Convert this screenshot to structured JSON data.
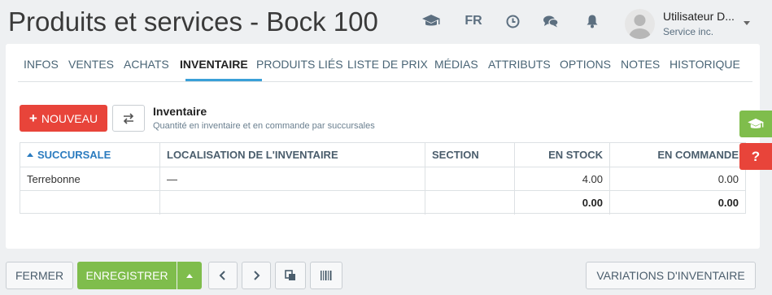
{
  "header": {
    "title": "Produits et services - Bock 100",
    "language": "FR",
    "icons": [
      "graduation-cap-icon",
      "clock-icon",
      "chat-icon",
      "bell-icon"
    ],
    "user": {
      "name": "Utilisateur D...",
      "org": "Service inc."
    }
  },
  "tabs": [
    "INFOS",
    "VENTES",
    "ACHATS",
    "INVENTAIRE",
    "PRODUITS LIÉS",
    "LISTE DE PRIX",
    "MÉDIAS",
    "ATTRIBUTS",
    "OPTIONS",
    "NOTES",
    "HISTORIQUE"
  ],
  "active_tab": "INVENTAIRE",
  "toolbar": {
    "new_label": "NOUVEAU",
    "new_icon": "plus-icon",
    "swap_icon": "swap-arrows-icon"
  },
  "section": {
    "title": "Inventaire",
    "subtitle": "Quantité en inventaire et en commande par succursales"
  },
  "table": {
    "columns": [
      "SUCCURSALE",
      "LOCALISATION DE L'INVENTAIRE",
      "SECTION",
      "EN STOCK",
      "EN COMMANDE"
    ],
    "sorted_column": "SUCCURSALE",
    "rows": [
      {
        "succursale": "Terrebonne",
        "localisation": "—",
        "section": "",
        "en_stock": "4.00",
        "en_commande": "0.00"
      }
    ],
    "totals": {
      "en_stock": "0.00",
      "en_commande": "0.00"
    }
  },
  "side": {
    "help_icon": "graduation-cap-icon",
    "question_label": "?"
  },
  "footer": {
    "close_label": "FERMER",
    "save_label": "ENREGISTRER",
    "variations_label": "VARIATIONS D'INVENTAIRE"
  },
  "colors": {
    "accent_red": "#e8443a",
    "accent_green": "#7fbd4c",
    "tab_underline": "#3aa0d8",
    "sort_blue": "#2a7bbf"
  }
}
